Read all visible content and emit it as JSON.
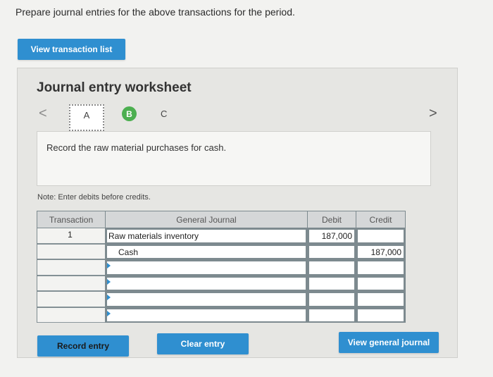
{
  "instruction": "Prepare journal entries for the above transactions for the period.",
  "view_transaction_list_label": "View transaction list",
  "worksheet": {
    "title": "Journal entry worksheet",
    "nav_prev": "<",
    "nav_next": ">",
    "steps": [
      "A",
      "B",
      "C"
    ],
    "active_step": "B",
    "description": "Record the raw material purchases for cash.",
    "note": "Note: Enter debits before credits."
  },
  "journal_table": {
    "headers": {
      "transaction": "Transaction",
      "general_journal": "General Journal",
      "debit": "Debit",
      "credit": "Credit"
    },
    "rows": [
      {
        "transaction": "1",
        "account": "Raw materials inventory",
        "debit": "187,000",
        "credit": ""
      },
      {
        "transaction": "",
        "account": "Cash",
        "debit": "",
        "credit": "187,000"
      },
      {
        "transaction": "",
        "account": "",
        "debit": "",
        "credit": ""
      },
      {
        "transaction": "",
        "account": "",
        "debit": "",
        "credit": ""
      },
      {
        "transaction": "",
        "account": "",
        "debit": "",
        "credit": ""
      },
      {
        "transaction": "",
        "account": "",
        "debit": "",
        "credit": ""
      }
    ]
  },
  "buttons": {
    "record_entry": "Record entry",
    "clear_entry": "Clear entry",
    "view_general_journal": "View general journal"
  },
  "colors": {
    "button_blue": "#2f8fd0",
    "active_step_green": "#4caf50"
  }
}
